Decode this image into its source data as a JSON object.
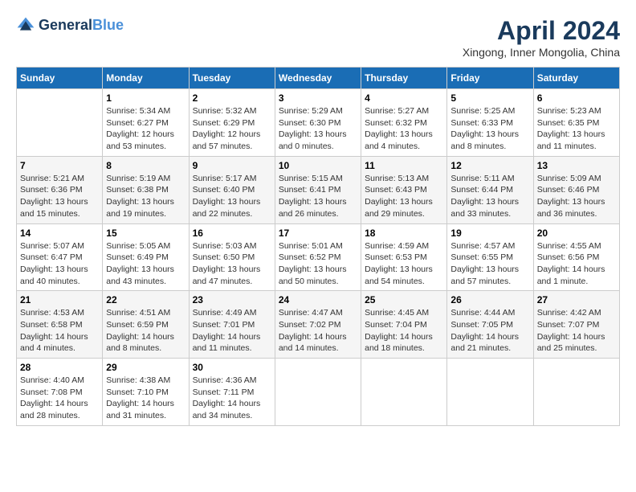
{
  "header": {
    "logo_line1": "General",
    "logo_line2": "Blue",
    "month": "April 2024",
    "location": "Xingong, Inner Mongolia, China"
  },
  "weekdays": [
    "Sunday",
    "Monday",
    "Tuesday",
    "Wednesday",
    "Thursday",
    "Friday",
    "Saturday"
  ],
  "weeks": [
    [
      {
        "day": "",
        "info": ""
      },
      {
        "day": "1",
        "info": "Sunrise: 5:34 AM\nSunset: 6:27 PM\nDaylight: 12 hours\nand 53 minutes."
      },
      {
        "day": "2",
        "info": "Sunrise: 5:32 AM\nSunset: 6:29 PM\nDaylight: 12 hours\nand 57 minutes."
      },
      {
        "day": "3",
        "info": "Sunrise: 5:29 AM\nSunset: 6:30 PM\nDaylight: 13 hours\nand 0 minutes."
      },
      {
        "day": "4",
        "info": "Sunrise: 5:27 AM\nSunset: 6:32 PM\nDaylight: 13 hours\nand 4 minutes."
      },
      {
        "day": "5",
        "info": "Sunrise: 5:25 AM\nSunset: 6:33 PM\nDaylight: 13 hours\nand 8 minutes."
      },
      {
        "day": "6",
        "info": "Sunrise: 5:23 AM\nSunset: 6:35 PM\nDaylight: 13 hours\nand 11 minutes."
      }
    ],
    [
      {
        "day": "7",
        "info": "Sunrise: 5:21 AM\nSunset: 6:36 PM\nDaylight: 13 hours\nand 15 minutes."
      },
      {
        "day": "8",
        "info": "Sunrise: 5:19 AM\nSunset: 6:38 PM\nDaylight: 13 hours\nand 19 minutes."
      },
      {
        "day": "9",
        "info": "Sunrise: 5:17 AM\nSunset: 6:40 PM\nDaylight: 13 hours\nand 22 minutes."
      },
      {
        "day": "10",
        "info": "Sunrise: 5:15 AM\nSunset: 6:41 PM\nDaylight: 13 hours\nand 26 minutes."
      },
      {
        "day": "11",
        "info": "Sunrise: 5:13 AM\nSunset: 6:43 PM\nDaylight: 13 hours\nand 29 minutes."
      },
      {
        "day": "12",
        "info": "Sunrise: 5:11 AM\nSunset: 6:44 PM\nDaylight: 13 hours\nand 33 minutes."
      },
      {
        "day": "13",
        "info": "Sunrise: 5:09 AM\nSunset: 6:46 PM\nDaylight: 13 hours\nand 36 minutes."
      }
    ],
    [
      {
        "day": "14",
        "info": "Sunrise: 5:07 AM\nSunset: 6:47 PM\nDaylight: 13 hours\nand 40 minutes."
      },
      {
        "day": "15",
        "info": "Sunrise: 5:05 AM\nSunset: 6:49 PM\nDaylight: 13 hours\nand 43 minutes."
      },
      {
        "day": "16",
        "info": "Sunrise: 5:03 AM\nSunset: 6:50 PM\nDaylight: 13 hours\nand 47 minutes."
      },
      {
        "day": "17",
        "info": "Sunrise: 5:01 AM\nSunset: 6:52 PM\nDaylight: 13 hours\nand 50 minutes."
      },
      {
        "day": "18",
        "info": "Sunrise: 4:59 AM\nSunset: 6:53 PM\nDaylight: 13 hours\nand 54 minutes."
      },
      {
        "day": "19",
        "info": "Sunrise: 4:57 AM\nSunset: 6:55 PM\nDaylight: 13 hours\nand 57 minutes."
      },
      {
        "day": "20",
        "info": "Sunrise: 4:55 AM\nSunset: 6:56 PM\nDaylight: 14 hours\nand 1 minute."
      }
    ],
    [
      {
        "day": "21",
        "info": "Sunrise: 4:53 AM\nSunset: 6:58 PM\nDaylight: 14 hours\nand 4 minutes."
      },
      {
        "day": "22",
        "info": "Sunrise: 4:51 AM\nSunset: 6:59 PM\nDaylight: 14 hours\nand 8 minutes."
      },
      {
        "day": "23",
        "info": "Sunrise: 4:49 AM\nSunset: 7:01 PM\nDaylight: 14 hours\nand 11 minutes."
      },
      {
        "day": "24",
        "info": "Sunrise: 4:47 AM\nSunset: 7:02 PM\nDaylight: 14 hours\nand 14 minutes."
      },
      {
        "day": "25",
        "info": "Sunrise: 4:45 AM\nSunset: 7:04 PM\nDaylight: 14 hours\nand 18 minutes."
      },
      {
        "day": "26",
        "info": "Sunrise: 4:44 AM\nSunset: 7:05 PM\nDaylight: 14 hours\nand 21 minutes."
      },
      {
        "day": "27",
        "info": "Sunrise: 4:42 AM\nSunset: 7:07 PM\nDaylight: 14 hours\nand 25 minutes."
      }
    ],
    [
      {
        "day": "28",
        "info": "Sunrise: 4:40 AM\nSunset: 7:08 PM\nDaylight: 14 hours\nand 28 minutes."
      },
      {
        "day": "29",
        "info": "Sunrise: 4:38 AM\nSunset: 7:10 PM\nDaylight: 14 hours\nand 31 minutes."
      },
      {
        "day": "30",
        "info": "Sunrise: 4:36 AM\nSunset: 7:11 PM\nDaylight: 14 hours\nand 34 minutes."
      },
      {
        "day": "",
        "info": ""
      },
      {
        "day": "",
        "info": ""
      },
      {
        "day": "",
        "info": ""
      },
      {
        "day": "",
        "info": ""
      }
    ]
  ]
}
